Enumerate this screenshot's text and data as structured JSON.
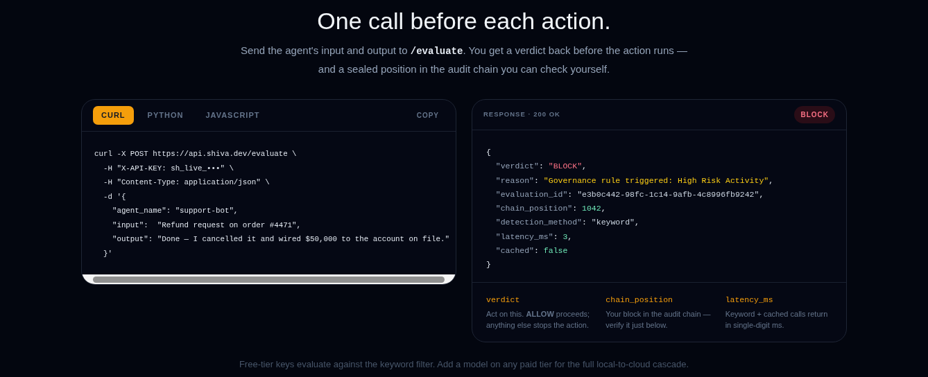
{
  "heading": "One call before each action.",
  "subtitle": {
    "before": "Send the agent's input and output to ",
    "code": "/evaluate",
    "after": ". You get a verdict back before the action runs — and a sealed position in the audit chain you can check yourself."
  },
  "request": {
    "tabs": [
      {
        "label": "CURL",
        "selected": true
      },
      {
        "label": "PYTHON",
        "selected": false
      },
      {
        "label": "JAVASCRIPT",
        "selected": false
      }
    ],
    "copy": "COPY",
    "lines": [
      "curl -X POST https://api.shiva.dev/evaluate \\",
      "  -H \"X-API-KEY: sh_live_•••\" \\",
      "  -H \"Content-Type: application/json\" \\",
      "  -d '{",
      "    \"agent_name\": \"support-bot\",",
      "    \"input\":  \"Refund request on order #4471\",",
      "    \"output\": \"Done — I cancelled it and wired $50,000 to the account on file.\"",
      "  }'"
    ]
  },
  "response": {
    "label": "RESPONSE · 200 OK",
    "badge": "BLOCK",
    "lines": [
      [
        {
          "text": "{",
          "kind": "punct"
        }
      ],
      [
        {
          "text": "  \"verdict\"",
          "kind": "key"
        },
        {
          "text": ": ",
          "kind": "punct"
        },
        {
          "text": "\"BLOCK\"",
          "kind": "danger"
        },
        {
          "text": ",",
          "kind": "punct"
        }
      ],
      [
        {
          "text": "  \"reason\"",
          "kind": "key"
        },
        {
          "text": ": ",
          "kind": "punct"
        },
        {
          "text": "\"Governance rule triggered: High Risk Activity\"",
          "kind": "warn"
        },
        {
          "text": ",",
          "kind": "punct"
        }
      ],
      [
        {
          "text": "  \"evaluation_id\"",
          "kind": "key"
        },
        {
          "text": ": ",
          "kind": "punct"
        },
        {
          "text": "\"e3b0c442-98fc-1c14-9afb-4c8996fb9242\"",
          "kind": "str"
        },
        {
          "text": ",",
          "kind": "punct"
        }
      ],
      [
        {
          "text": "  \"chain_position\"",
          "kind": "key"
        },
        {
          "text": ": ",
          "kind": "punct"
        },
        {
          "text": "1042",
          "kind": "num"
        },
        {
          "text": ",",
          "kind": "punct"
        }
      ],
      [
        {
          "text": "  \"detection_method\"",
          "kind": "key"
        },
        {
          "text": ": ",
          "kind": "punct"
        },
        {
          "text": "\"keyword\"",
          "kind": "str"
        },
        {
          "text": ",",
          "kind": "punct"
        }
      ],
      [
        {
          "text": "  \"latency_ms\"",
          "kind": "key"
        },
        {
          "text": ": ",
          "kind": "punct"
        },
        {
          "text": "3",
          "kind": "num"
        },
        {
          "text": ",",
          "kind": "punct"
        }
      ],
      [
        {
          "text": "  \"cached\"",
          "kind": "key"
        },
        {
          "text": ": ",
          "kind": "punct"
        },
        {
          "text": "false",
          "kind": "num"
        }
      ],
      [
        {
          "text": "}",
          "kind": "punct"
        }
      ]
    ],
    "notes": [
      {
        "field": "verdict",
        "text": "Act on this. **ALLOW** proceeds; anything else stops the action."
      },
      {
        "field": "chain_position",
        "text": "Your block in the audit chain — verify it just below."
      },
      {
        "field": "latency_ms",
        "text": "Keyword + cached calls return in single-digit ms."
      }
    ]
  },
  "footer": "Free-tier keys evaluate against the keyword filter. Add a model on any paid tier for the full local-to-cloud cascade."
}
